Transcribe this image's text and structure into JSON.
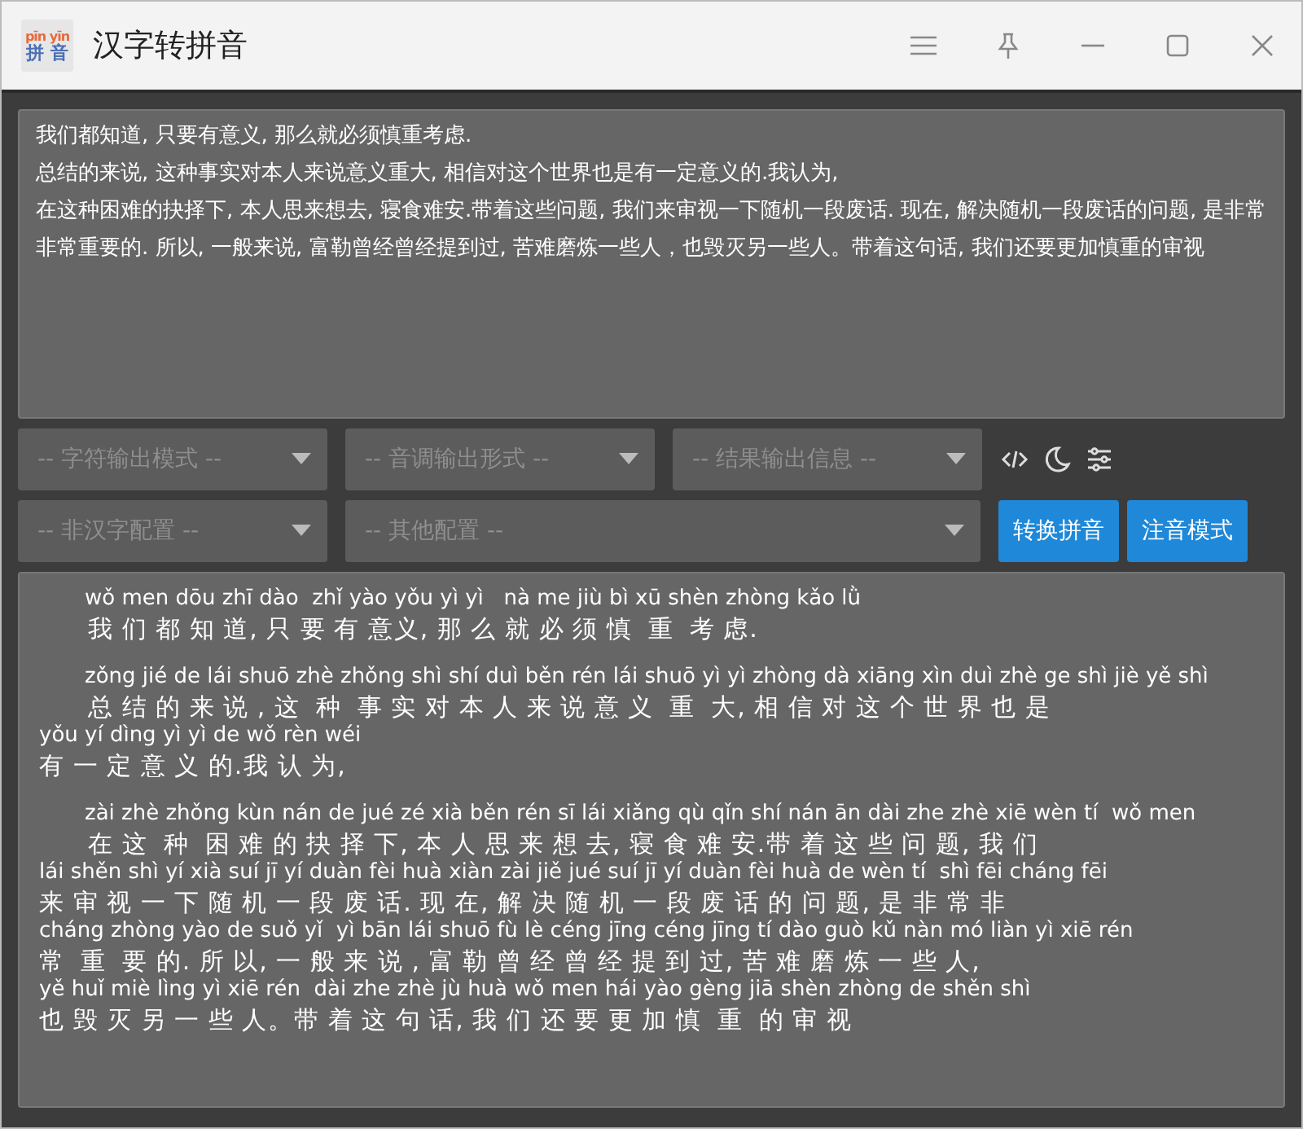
{
  "window": {
    "title": "汉字转拼音",
    "logo": {
      "top": "pīn yīn",
      "bottom": "拼 音"
    }
  },
  "input": {
    "value": "我们都知道, 只要有意义, 那么就必须慎重考虑.\n总结的来说, 这种事实对本人来说意义重大, 相信对这个世界也是有一定意义的.我认为,\n在这种困难的抉择下, 本人思来想去, 寝食难安.带着这些问题, 我们来审视一下随机一段废话. 现在, 解决随机一段废话的问题, 是非常非常重要的. 所以, 一般来说, 富勒曾经曾经提到过, 苦难磨炼一些人，也毁灭另一些人。带着这句话, 我们还要更加慎重的审视"
  },
  "selects_row_1": [
    {
      "placeholder": "-- 字符输出模式 --"
    },
    {
      "placeholder": "-- 音调输出形式 --"
    },
    {
      "placeholder": "-- 结果输出信息 --"
    }
  ],
  "tool_icons": [
    {
      "kind": "code"
    },
    {
      "kind": "moon"
    },
    {
      "kind": "sliders"
    }
  ],
  "selects_row_2": [
    {
      "placeholder": "-- 非汉字配置 --"
    },
    {
      "placeholder": "-- 其他配置 --"
    }
  ],
  "buttons": [
    {
      "label": "转换拼音"
    },
    {
      "label": "注音模式"
    }
  ],
  "output": [
    {
      "lines": [
        {
          "pinyin": "wǒ men dōu zhī dào  zhǐ yào yǒu yì yì   nà me jiù bì xū shèn zhòng kǎo lǜ",
          "hanzi": "我 们 都 知 道, 只 要 有 意义, 那 么 就 必 须 慎  重  考 虑."
        }
      ]
    },
    {
      "lines": [
        {
          "pinyin": "zǒng jié de lái shuō zhè zhǒng shì shí duì běn rén lái shuō yì yì zhòng dà xiāng xìn duì zhè ge shì jiè yě shì",
          "hanzi": "总 结 的 来 说 , 这  种  事 实 对 本 人 来 说 意 义  重  大, 相 信 对 这 个 世 界 也 是"
        },
        {
          "pinyin": "yǒu yí dìng yì yì de wǒ rèn wéi",
          "hanzi": "有 一 定 意 义 的.我 认 为,"
        }
      ]
    },
    {
      "lines": [
        {
          "pinyin": "zài zhè zhǒng kùn nán de jué zé xià běn rén sī lái xiǎng qù qǐn shí nán ān dài zhe zhè xiē wèn tí  wǒ men",
          "hanzi": "在 这  种  困 难 的 抉 择 下, 本 人 思 来 想 去, 寝 食 难 安.带 着 这 些 问 题, 我 们"
        },
        {
          "pinyin": "lái shěn shì yí xià suí jī yí duàn fèi huà xiàn zài jiě jué suí jī yí duàn fèi huà de wèn tí  shì fēi cháng fēi",
          "hanzi": "来 审 视 一 下 随 机 一 段 废 话. 现 在, 解 决 随 机 一 段 废 话 的 问 题, 是 非 常 非"
        },
        {
          "pinyin": "cháng zhòng yào de suǒ yǐ  yì bān lái shuō fù lè céng jīng céng jīng tí dào guò kǔ nàn mó liàn yì xiē rén",
          "hanzi": "常  重  要 的. 所 以, 一 般 来 说 , 富 勒 曾 经 曾 经 提 到 过, 苦 难 磨 炼 一 些 人,"
        },
        {
          "pinyin": "yě huǐ miè lìng yì xiē rén  dài zhe zhè jù huà wǒ men hái yào gèng jiā shèn zhòng de shěn shì",
          "hanzi": "也 毁 灭 另 一 些 人。带 着 这 句 话, 我 们 还 要 更 加 慎  重  的 审 视"
        }
      ]
    }
  ]
}
